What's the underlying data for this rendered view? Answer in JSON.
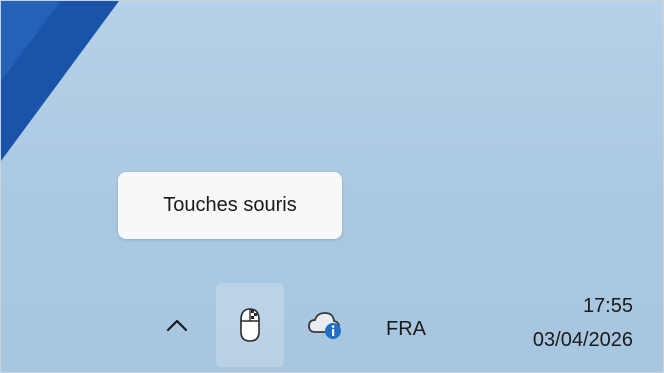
{
  "tooltip": {
    "text": "Touches souris"
  },
  "tray": {
    "icons": [
      "chevron-up-icon",
      "mouse-keys-icon",
      "cloud-info-icon"
    ],
    "language": "FRA"
  },
  "clock": {
    "time": "17:55",
    "date": "03/04/2026"
  },
  "colors": {
    "desktop": "#a9c8e0",
    "wallpaper_accent": "#1a54a8",
    "tooltip_bg": "#f7f8f9",
    "info_badge": "#1f6fc6"
  }
}
